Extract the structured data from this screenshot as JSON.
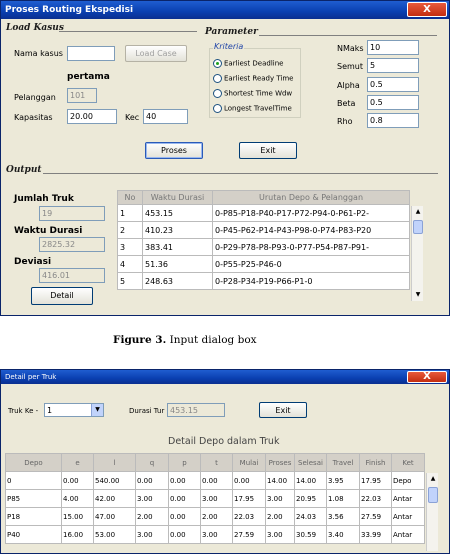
{
  "window1": {
    "title": "Proses Routing Ekspedisi",
    "close_label": "X",
    "load_section": "Load Kasus",
    "nama_kasus_label": "Nama kasus",
    "nama_kasus_value": "",
    "load_case_button": "Load Case",
    "case_name": "pertama",
    "pelanggan_label": "Pelanggan",
    "pelanggan_value": "101",
    "kapasitas_label": "Kapasitas",
    "kapasitas_value": "20.00",
    "kec_label": "Kec",
    "kec_value": "40",
    "parameter_section": "Parameter",
    "kriteria_label": "Kriteria",
    "criteria": [
      {
        "label": "Earliest Deadline",
        "selected": true
      },
      {
        "label": "Earliest Ready Time",
        "selected": false
      },
      {
        "label": "Shortest Time Wdw",
        "selected": false
      },
      {
        "label": "Longest TravelTime",
        "selected": false
      }
    ],
    "params": [
      {
        "label": "NMaks",
        "value": "10"
      },
      {
        "label": "Semut",
        "value": "5"
      },
      {
        "label": "Alpha",
        "value": "0.5"
      },
      {
        "label": "Beta",
        "value": "0.5"
      },
      {
        "label": "Rho",
        "value": "0.8"
      }
    ],
    "proses_button": "Proses",
    "exit_button": "Exit",
    "output_section": "Output",
    "jumlah_truk_label": "Jumlah Truk",
    "jumlah_truk_value": "19",
    "waktu_durasi_label": "Waktu Durasi",
    "waktu_durasi_value": "2825.32",
    "deviasi_label": "Deviasi",
    "deviasi_value": "416.01",
    "detail_button": "Detail",
    "table": {
      "headers": [
        "No",
        "Waktu Durasi",
        "Urutan Depo & Pelanggan"
      ],
      "rows": [
        [
          "1",
          "453.15",
          "0-P85-P18-P40-P17-P72-P94-0-P61-P2-"
        ],
        [
          "2",
          "410.23",
          "0-P45-P62-P14-P43-P98-0-P74-P83-P20"
        ],
        [
          "3",
          "383.41",
          "0-P29-P78-P8-P93-0-P77-P54-P87-P91-"
        ],
        [
          "4",
          "51.36",
          "0-P55-P25-P46-0"
        ],
        [
          "5",
          "248.63",
          "0-P28-P34-P19-P66-P1-0"
        ]
      ]
    }
  },
  "caption1": {
    "bold": "Figure 3.",
    "rest": " Input dialog box"
  },
  "window2": {
    "title": "Detail per Truk",
    "close_label": "X",
    "truk_label": "Truk Ke -",
    "truk_value": "1",
    "durasi_label": "Durasi Tur",
    "durasi_value": "453.15",
    "exit_button": "Exit",
    "table_title": "Detail Depo dalam Truk",
    "headers": [
      "Depo",
      "e",
      "l",
      "q",
      "p",
      "t",
      "Mulai",
      "Proses",
      "Selesai",
      "Travel",
      "Finish",
      "Ket"
    ],
    "rows": [
      [
        "0",
        "0.00",
        "540.00",
        "0.00",
        "0.00",
        "0.00",
        "0.00",
        "14.00",
        "14.00",
        "3.95",
        "17.95",
        "Depo"
      ],
      [
        "P85",
        "4.00",
        "42.00",
        "3.00",
        "0.00",
        "3.00",
        "17.95",
        "3.00",
        "20.95",
        "1.08",
        "22.03",
        "Antar"
      ],
      [
        "P18",
        "15.00",
        "47.00",
        "2.00",
        "0.00",
        "2.00",
        "22.03",
        "2.00",
        "24.03",
        "3.56",
        "27.59",
        "Antar"
      ],
      [
        "P40",
        "16.00",
        "53.00",
        "3.00",
        "0.00",
        "3.00",
        "27.59",
        "3.00",
        "30.59",
        "3.40",
        "33.99",
        "Antar"
      ]
    ]
  }
}
